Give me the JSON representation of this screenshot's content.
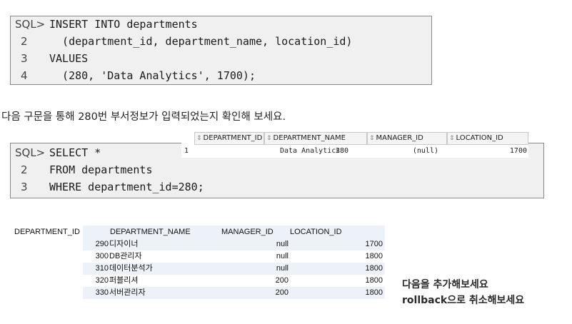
{
  "code_block_1": {
    "lines": [
      {
        "num": "SQL>",
        "code": "INSERT INTO departments"
      },
      {
        "num": "2",
        "code": "  (department_id, department_name, location_id)"
      },
      {
        "num": "3",
        "code": "VALUES"
      },
      {
        "num": "4",
        "code": "  (280, 'Data Analytics', 1700);"
      }
    ]
  },
  "caption": "다음 구문을 통해 280번 부서정보가 입력되었는지 확인해 보세요.",
  "code_block_2": {
    "lines": [
      {
        "num": "SQL>",
        "code": "SELECT *"
      },
      {
        "num": "2",
        "code": "FROM departments"
      },
      {
        "num": "3",
        "code": "WHERE department_id=280;"
      }
    ]
  },
  "result_grid": {
    "sort_icon": "sort-icon",
    "columns": [
      "DEPARTMENT_ID",
      "DEPARTMENT_NAME",
      "MANAGER_ID",
      "LOCATION_ID"
    ],
    "row_number": "1",
    "row": [
      "280",
      "Data Analytics",
      "(null)",
      "1700"
    ]
  },
  "table": {
    "columns": [
      "DEPARTMENT_ID",
      "DEPARTMENT_NAME",
      "MANAGER_ID",
      "LOCATION_ID"
    ],
    "rows": [
      {
        "id": "290",
        "name": "디자이너",
        "manager": "null",
        "location": "1700"
      },
      {
        "id": "300",
        "name": "DB관리자",
        "manager": "null",
        "location": "1800"
      },
      {
        "id": "310",
        "name": "데이터분석가",
        "manager": "null",
        "location": "1800"
      },
      {
        "id": "320",
        "name": "퍼블리셔",
        "manager": "200",
        "location": "1800"
      },
      {
        "id": "330",
        "name": "서버관리자",
        "manager": "200",
        "location": "1800"
      }
    ]
  },
  "notes": [
    "다음을 추가해보세요",
    "rollback으로 취소해보세요"
  ]
}
